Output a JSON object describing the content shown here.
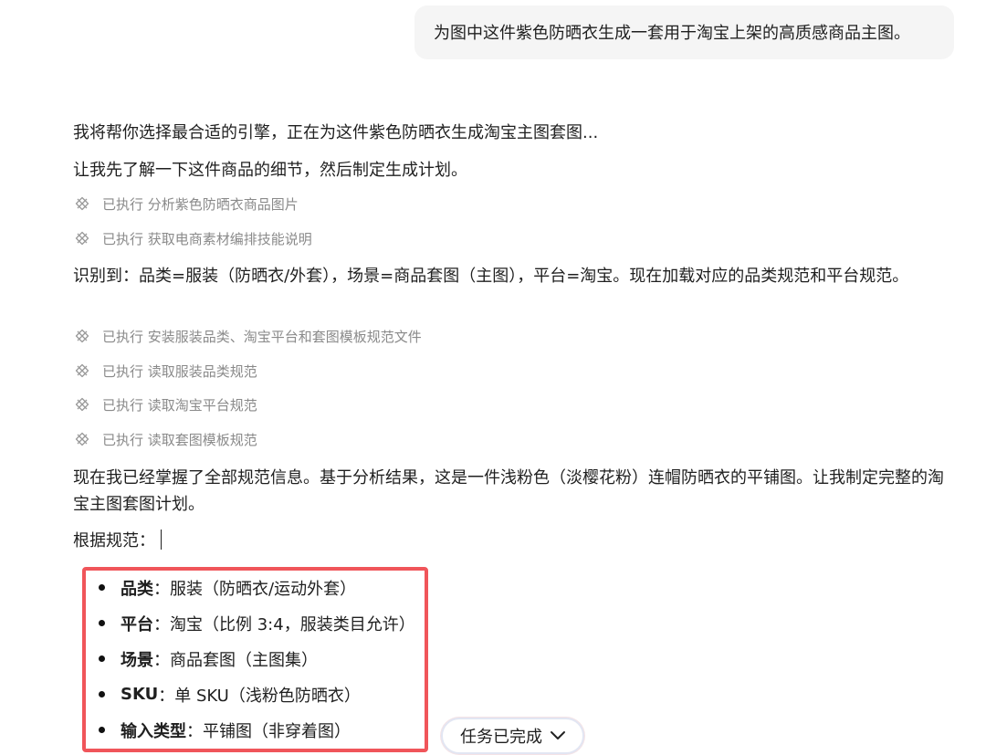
{
  "user_message": "为图中这件紫色防晒衣生成一套用于淘宝上架的高质感商品主图。",
  "assistant": {
    "intro_1": "我将帮你选择最合适的引擎，正在为这件紫色防晒衣生成淘宝主图套图...",
    "intro_2": "让我先了解一下这件商品的细节，然后制定生成计划。",
    "steps_group_1": [
      {
        "status": "已执行",
        "label": "分析紫色防晒衣商品图片"
      },
      {
        "status": "已执行",
        "label": "获取电商素材编排技能说明"
      }
    ],
    "identified": "识别到：品类=服装（防晒衣/外套），场景=商品套图（主图），平台=淘宝。现在加载对应的品类规范和平台规范。",
    "steps_group_2": [
      {
        "status": "已执行",
        "label": "安装服装品类、淘宝平台和套图模板规范文件"
      },
      {
        "status": "已执行",
        "label": "读取服装品类规范"
      },
      {
        "status": "已执行",
        "label": "读取淘宝平台规范"
      },
      {
        "status": "已执行",
        "label": "读取套图模板规范"
      }
    ],
    "summary": "现在我已经掌握了全部规范信息。基于分析结果，这是一件浅粉色（淡樱花粉）连帽防晒衣的平铺图。让我制定完整的淘宝主图套图计划。",
    "according": "根据规范：",
    "spec_items": [
      {
        "key": "品类",
        "value": "服装（防晒衣/运动外套）"
      },
      {
        "key": "平台",
        "value": "淘宝（比例 3:4，服装类目允许）"
      },
      {
        "key": "场景",
        "value": "商品套图（主图集）"
      },
      {
        "key": "SKU",
        "value": "单 SKU（浅粉色防晒衣）"
      },
      {
        "key": "输入类型",
        "value": "平铺图（非穿着图）"
      }
    ],
    "colon": "：",
    "task_status": "任务已完成"
  },
  "icons": {
    "step": "tool-executed-icon",
    "task_toggle": "chevron-down-icon"
  },
  "colors": {
    "highlight_border": "#f0555a",
    "bubble_bg": "#f5f5f5",
    "muted_text": "#8a8a8a"
  }
}
